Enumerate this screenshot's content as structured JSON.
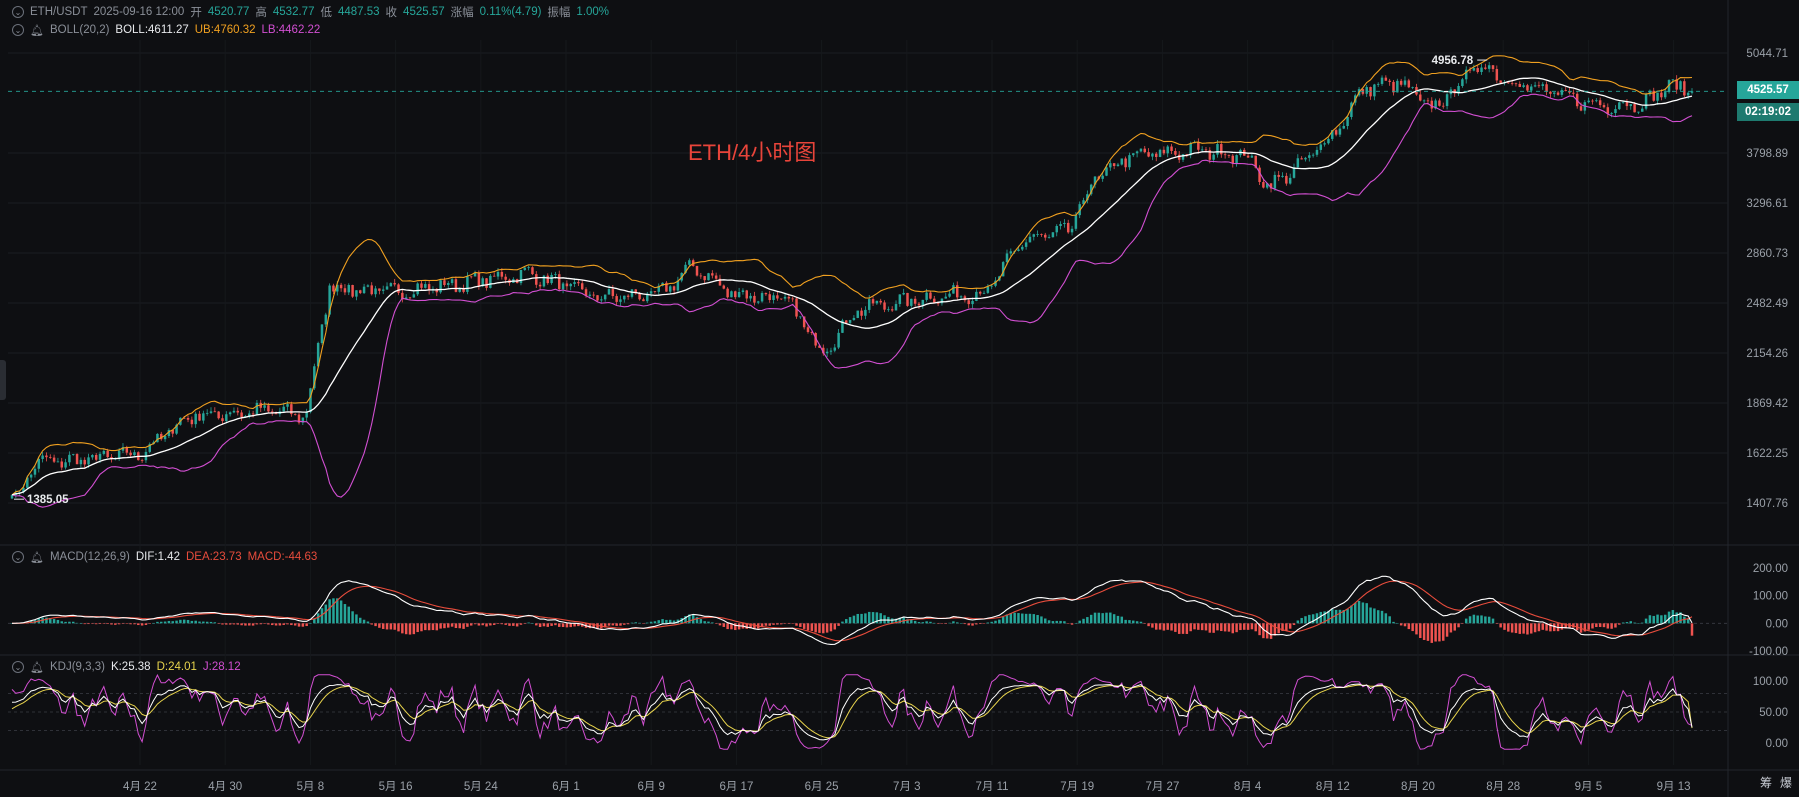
{
  "header": {
    "symbol": "ETH/USDT",
    "datetime": "2025-09-16 12:00",
    "open_label": "开",
    "open": "4520.77",
    "high_label": "高",
    "high": "4532.77",
    "low_label": "低",
    "low": "4487.53",
    "close_label": "收",
    "close": "4525.57",
    "change_label": "涨幅",
    "change": "0.11%(4.79)",
    "amplitude_label": "振幅",
    "amplitude": "1.00%"
  },
  "boll": {
    "name": "BOLL(20,2)",
    "mid": "BOLL:4611.27",
    "ub": "UB:4760.32",
    "lb": "LB:4462.22"
  },
  "macd": {
    "name": "MACD(12,26,9)",
    "dif": "DIF:1.42",
    "dea": "DEA:23.73",
    "macd": "MACD:-44.63"
  },
  "kdj": {
    "name": "KDJ(9,3,3)",
    "k": "K:25.38",
    "d": "D:24.01",
    "j": "J:28.12"
  },
  "title": "ETH/4小时图",
  "current_price": "4525.57",
  "countdown": "02:19:02",
  "high_marker": "4956.78",
  "low_marker": "1385.05",
  "corner_buttons": [
    "筹",
    "爆"
  ],
  "colors": {
    "up": "#26a69a",
    "down": "#ef5350",
    "boll_mid": "#ffffff",
    "boll_ub": "#f0a020",
    "boll_lb": "#d24fd2",
    "dif": "#ffffff",
    "dea": "#e74c3c",
    "k": "#ffffff",
    "d": "#e8d44d",
    "j": "#d24fd2",
    "accent": "#26a69a"
  },
  "chart_data": [
    {
      "type": "candlestick",
      "title": "ETH/4小时图",
      "scale": "log",
      "yticks": [
        "5044.71",
        "3798.89",
        "3296.61",
        "2860.73",
        "2482.49",
        "2154.26",
        "1869.42",
        "1622.25",
        "1407.76"
      ],
      "xticks": [
        "4月 22",
        "4月 30",
        "5月 8",
        "5月 16",
        "5月 24",
        "6月 1",
        "6月 9",
        "6月 17",
        "6月 25",
        "7月 3",
        "7月 11",
        "7月 19",
        "7月 27",
        "8月 4",
        "8月 12",
        "8月 20",
        "8月 28",
        "9月 5",
        "9月 13"
      ],
      "price_path": [
        [
          0,
          1385
        ],
        [
          2,
          1580
        ],
        [
          6,
          1590
        ],
        [
          11,
          1620
        ],
        [
          15,
          1800
        ],
        [
          22,
          1830
        ],
        [
          25,
          1800
        ],
        [
          27,
          2600
        ],
        [
          32,
          2560
        ],
        [
          38,
          2620
        ],
        [
          44,
          2700
        ],
        [
          50,
          2520
        ],
        [
          55,
          2540
        ],
        [
          58,
          2760
        ],
        [
          61,
          2560
        ],
        [
          66,
          2500
        ],
        [
          69,
          2160
        ],
        [
          72,
          2440
        ],
        [
          78,
          2520
        ],
        [
          83,
          2560
        ],
        [
          86,
          2960
        ],
        [
          90,
          3050
        ],
        [
          92,
          3500
        ],
        [
          95,
          3760
        ],
        [
          101,
          3830
        ],
        [
          105,
          3780
        ],
        [
          107,
          3450
        ],
        [
          110,
          3700
        ],
        [
          113,
          4100
        ],
        [
          115,
          4560
        ],
        [
          118,
          4640
        ],
        [
          121,
          4300
        ],
        [
          123,
          4600
        ],
        [
          125,
          4900
        ],
        [
          127,
          4690
        ],
        [
          131,
          4500
        ],
        [
          135,
          4350
        ],
        [
          139,
          4380
        ],
        [
          141,
          4600
        ],
        [
          143,
          4526
        ]
      ],
      "boll": {
        "period": 20,
        "k": 2
      },
      "current_price": 4525.57,
      "annotations": [
        "4956.78",
        "1385.05"
      ]
    },
    {
      "type": "bar+line",
      "name": "MACD(12,26,9)",
      "yticks": [
        "200.00",
        "100.00",
        "0.00",
        "-100.00"
      ],
      "ylim": [
        -100,
        200
      ],
      "series": [
        {
          "name": "DIF",
          "last": 1.42
        },
        {
          "name": "DEA",
          "last": 23.73
        },
        {
          "name": "MACD",
          "last": -44.63
        }
      ]
    },
    {
      "type": "line",
      "name": "KDJ(9,3,3)",
      "yticks": [
        "100.00",
        "50.00",
        "0.00"
      ],
      "ylim": [
        -10,
        110
      ],
      "series": [
        {
          "name": "K",
          "last": 25.38
        },
        {
          "name": "D",
          "last": 24.01
        },
        {
          "name": "J",
          "last": 28.12
        }
      ]
    }
  ]
}
